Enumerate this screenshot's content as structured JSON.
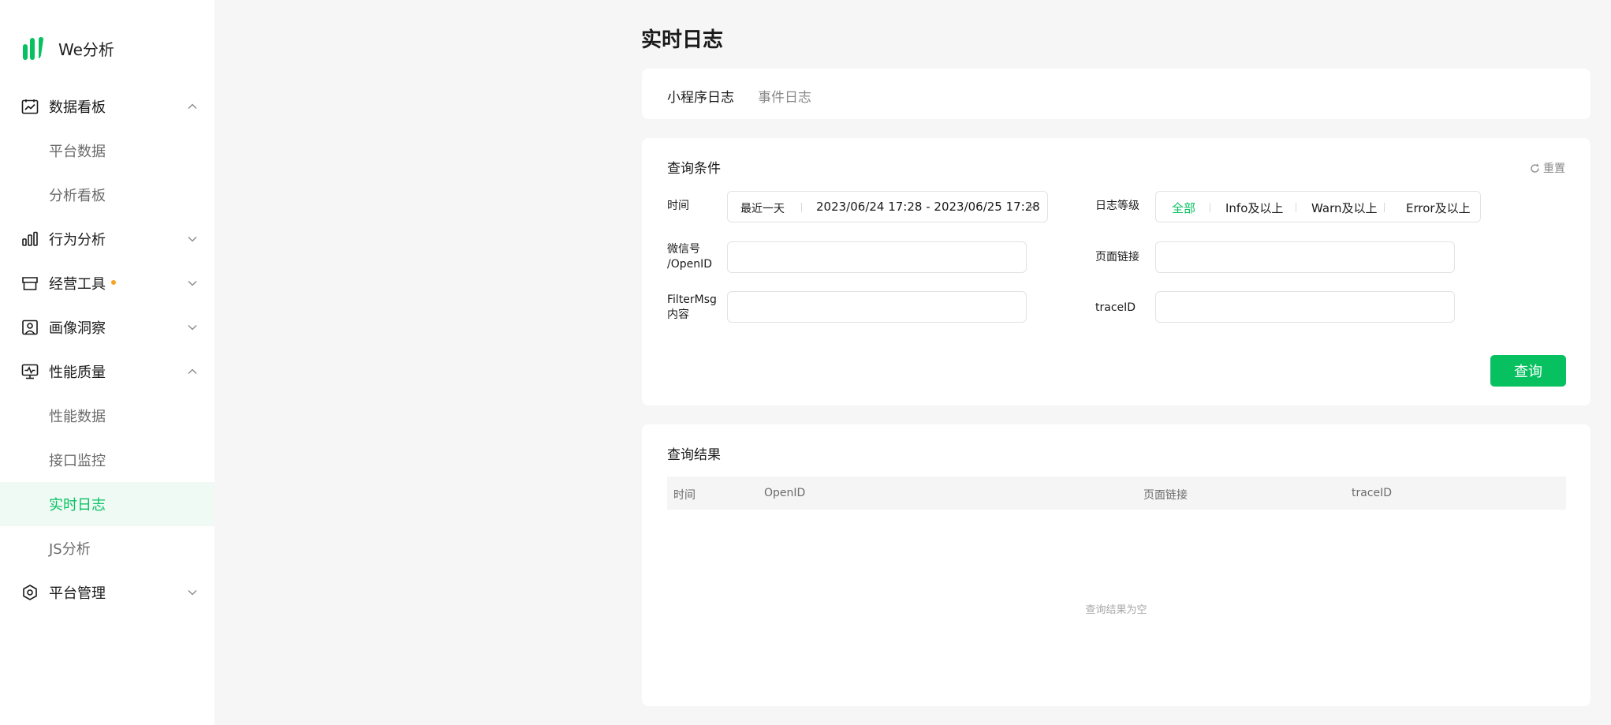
{
  "app": {
    "name": "We分析"
  },
  "sidebar": {
    "groups": [
      {
        "label": "数据看板",
        "icon": "dashboard-icon",
        "expanded": true
      },
      {
        "label": "行为分析",
        "icon": "bar-chart-icon",
        "expanded": false
      },
      {
        "label": "经营工具",
        "icon": "shop-icon",
        "expanded": false,
        "has_dot": true
      },
      {
        "label": "画像洞察",
        "icon": "portrait-icon",
        "expanded": false
      },
      {
        "label": "性能质量",
        "icon": "monitor-icon",
        "expanded": true
      },
      {
        "label": "平台管理",
        "icon": "hexagon-settings-icon",
        "expanded": false
      }
    ],
    "subitems": [
      {
        "label": "平台数据"
      },
      {
        "label": "分析看板"
      },
      {
        "label": "性能数据"
      },
      {
        "label": "接口监控"
      },
      {
        "label": "实时日志",
        "active": true
      },
      {
        "label": "JS分析"
      }
    ]
  },
  "page": {
    "title": "实时日志"
  },
  "tabs": [
    {
      "label": "小程序日志",
      "active": true
    },
    {
      "label": "事件日志",
      "active": false
    }
  ],
  "query": {
    "title": "查询条件",
    "reset_label": "重置",
    "time_label": "时间",
    "time_range_type": "最近一天",
    "time_range": "2023/06/24 17:28 - 2023/06/25 17:28",
    "level_label": "日志等级",
    "levels": [
      {
        "label": "全部",
        "selected": true
      },
      {
        "label": "Info及以上",
        "selected": false
      },
      {
        "label": "Warn及以上",
        "selected": false
      },
      {
        "label": "Error及以上",
        "selected": false
      }
    ],
    "wechat_label_line1": "微信号",
    "wechat_label_line2": "/OpenID",
    "wechat_value": "",
    "page_link_label": "页面链接",
    "page_link_value": "",
    "filter_label_line1": "FilterMsg",
    "filter_label_line2": "内容",
    "filter_value": "",
    "trace_label": "traceID",
    "trace_value": "",
    "submit_label": "查询"
  },
  "results": {
    "title": "查询结果",
    "columns": [
      "时间",
      "OpenID",
      "页面链接",
      "traceID"
    ],
    "empty_text": "查询结果为空"
  },
  "colors": {
    "accent": "#07c160",
    "badge_dot": "#f6a323",
    "background": "#f6f6f6",
    "active_nav_bg": "#effaf5"
  }
}
